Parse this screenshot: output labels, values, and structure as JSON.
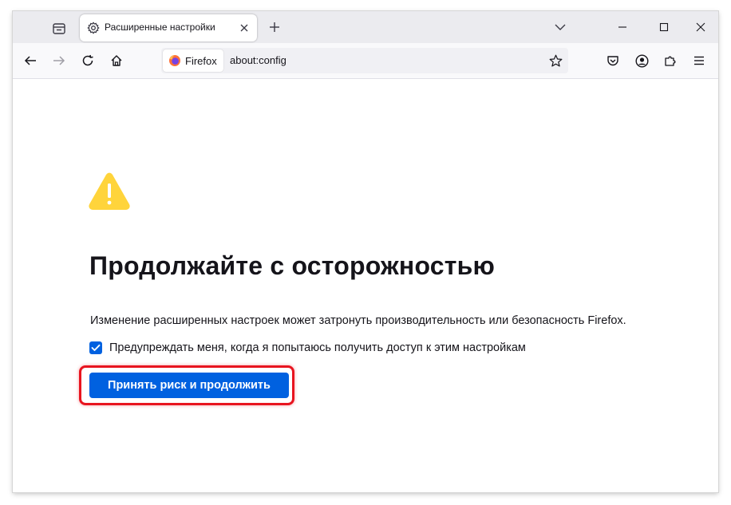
{
  "tab": {
    "title": "Расширенные настройки",
    "icon": "gear-icon"
  },
  "toolbar": {
    "identity_label": "Firefox",
    "url": "about:config"
  },
  "page": {
    "heading": "Продолжайте с осторожностью",
    "description": "Изменение расширенных настроек может затронуть производительность или безопасность Firefox.",
    "checkbox_label": "Предупреждать меня, когда я попытаюсь получить доступ к этим настройкам",
    "checkbox_checked": true,
    "accept_button_label": "Принять риск и продолжить"
  },
  "colors": {
    "accent": "#0061e0",
    "warning": "#ffd43b",
    "highlight": "#e8141f",
    "tabbar_bg": "#ebebef"
  }
}
